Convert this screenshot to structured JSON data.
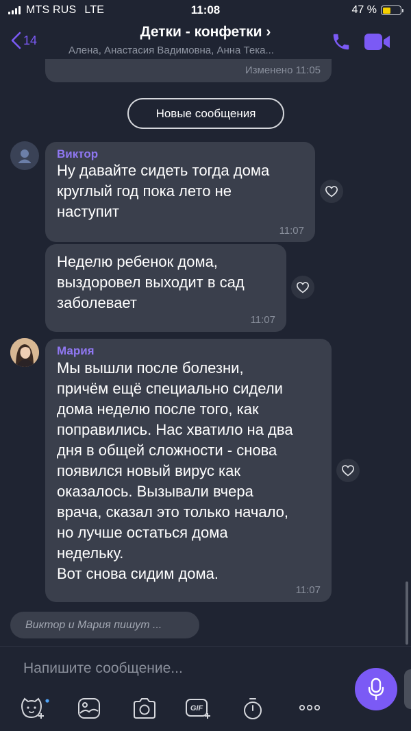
{
  "status_bar": {
    "carrier": "MTS RUS",
    "network": "LTE",
    "time": "11:08",
    "battery": "47 %",
    "battery_level": 0.47
  },
  "header": {
    "back_count": "14",
    "title": "Детки - конфетки ›",
    "subtitle": "Алена, Анастасия Вадимовна, Анна Тека...",
    "accent_color": "#7b5af5"
  },
  "chat": {
    "edited_label": "Изменено  11:05",
    "new_messages_label": "Новые сообщения",
    "messages": [
      {
        "sender": "Виктор",
        "lines": [
          "Ну давайте сидеть тогда дома",
          "круглый год пока лето не",
          "наступит"
        ],
        "time": "11:07"
      },
      {
        "sender": "",
        "lines": [
          "Неделю ребенок дома,",
          "выздоровел выходит в сад",
          "заболевает"
        ],
        "time": "11:07"
      },
      {
        "sender": "Мария",
        "lines": [
          "Мы вышли после болезни,",
          "причём ещё специально сидели",
          "дома неделю после того, как",
          "поправились. Нас хватило на два",
          "дня в общей сложности - снова",
          "появился новый вирус как",
          "оказалось. Вызывали вчера",
          "врача, сказал это только начало,",
          "но лучше остаться дома",
          "недельку.",
          "Вот снова сидим дома."
        ],
        "time": "11:07"
      }
    ],
    "typing": "Виктор и Мария пишут ..."
  },
  "composer": {
    "placeholder": "Напишите сообщение...",
    "tools": [
      "sticker-icon",
      "gallery-icon",
      "camera-icon",
      "gif-icon",
      "timer-icon",
      "more-icon"
    ],
    "gif_label": "GIF"
  }
}
